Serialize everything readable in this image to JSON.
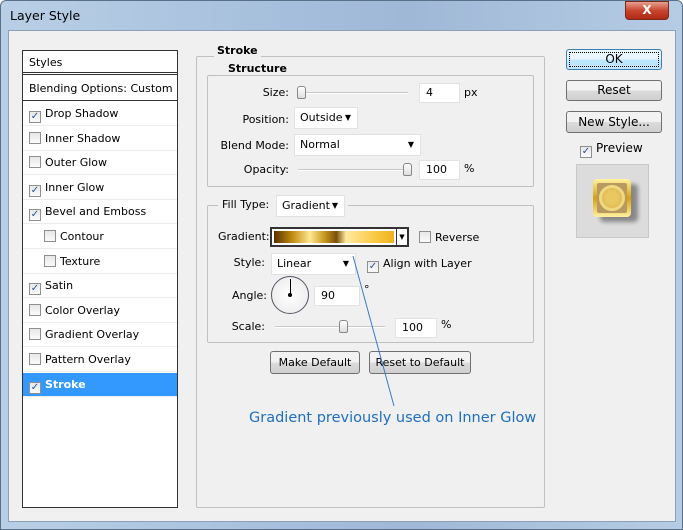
{
  "window": {
    "title": "Layer Style",
    "close_label": "X"
  },
  "styles_list": {
    "header": "Styles",
    "blending": "Blending Options: Custom",
    "items": [
      {
        "label": "Drop Shadow",
        "checked": true
      },
      {
        "label": "Inner Shadow",
        "checked": false
      },
      {
        "label": "Outer Glow",
        "checked": false
      },
      {
        "label": "Inner Glow",
        "checked": true
      },
      {
        "label": "Bevel and Emboss",
        "checked": true
      },
      {
        "label": "Contour",
        "checked": false,
        "sub": true
      },
      {
        "label": "Texture",
        "checked": false,
        "sub": true
      },
      {
        "label": "Satin",
        "checked": true
      },
      {
        "label": "Color Overlay",
        "checked": false
      },
      {
        "label": "Gradient Overlay",
        "checked": false
      },
      {
        "label": "Pattern Overlay",
        "checked": false
      },
      {
        "label": "Stroke",
        "checked": true,
        "selected": true
      }
    ]
  },
  "stroke": {
    "title": "Stroke",
    "structure": {
      "title": "Structure",
      "size_label": "Size:",
      "size_value": "4",
      "size_unit": "px",
      "position_label": "Position:",
      "position_value": "Outside",
      "blend_label": "Blend Mode:",
      "blend_value": "Normal",
      "opacity_label": "Opacity:",
      "opacity_value": "100",
      "opacity_unit": "%"
    },
    "fill": {
      "type_label": "Fill Type:",
      "type_value": "Gradient",
      "gradient_label": "Gradient:",
      "reverse_label": "Reverse",
      "reverse_checked": false,
      "style_label": "Style:",
      "style_value": "Linear",
      "align_label": "Align with Layer",
      "align_checked": true,
      "angle_label": "Angle:",
      "angle_value": "90",
      "angle_unit": "°",
      "scale_label": "Scale:",
      "scale_value": "100",
      "scale_unit": "%"
    },
    "make_default": "Make Default",
    "reset_default": "Reset to Default"
  },
  "buttons": {
    "ok": "OK",
    "reset": "Reset",
    "new_style": "New Style...",
    "preview_label": "Preview",
    "preview_checked": true
  },
  "annotation": {
    "text": "Gradient previously used on Inner Glow",
    "color": "#1f6fbf"
  }
}
